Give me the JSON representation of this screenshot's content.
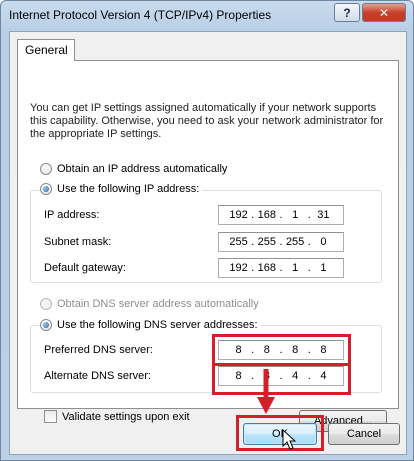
{
  "window": {
    "title": "Internet Protocol Version 4 (TCP/IPv4) Properties",
    "help_glyph": "?",
    "close_glyph": "✕"
  },
  "tabs": [
    {
      "label": "General",
      "selected": true
    }
  ],
  "intro_text": "You can get IP settings assigned automatically if your network supports this capability. Otherwise, you need to ask your network administrator for the appropriate IP settings.",
  "ip_section": {
    "auto_label": "Obtain an IP address automatically",
    "manual_label": "Use the following IP address:",
    "selected": "manual",
    "fields": [
      {
        "label": "IP address:",
        "value": [
          "192",
          "168",
          "1",
          "31"
        ]
      },
      {
        "label": "Subnet mask:",
        "value": [
          "255",
          "255",
          "255",
          "0"
        ]
      },
      {
        "label": "Default gateway:",
        "value": [
          "192",
          "168",
          "1",
          "1"
        ]
      }
    ]
  },
  "dns_section": {
    "auto_label": "Obtain DNS server address automatically",
    "auto_disabled": true,
    "manual_label": "Use the following DNS server addresses:",
    "selected": "manual",
    "fields": [
      {
        "label": "Preferred DNS server:",
        "value": [
          "8",
          "8",
          "8",
          "8"
        ]
      },
      {
        "label": "Alternate DNS server:",
        "value": [
          "8",
          "8",
          "4",
          "4"
        ]
      }
    ]
  },
  "validate": {
    "label": "Validate settings upon exit",
    "checked": false
  },
  "buttons": {
    "advanced": "Advanced...",
    "ok": "OK",
    "cancel": "Cancel"
  },
  "colors": {
    "highlight": "#d21f2a",
    "accent": "#1f5ea8"
  },
  "annotations": {
    "arrow_icon": "red-arrow-icon",
    "cursor_icon": "mouse-pointer-icon"
  }
}
